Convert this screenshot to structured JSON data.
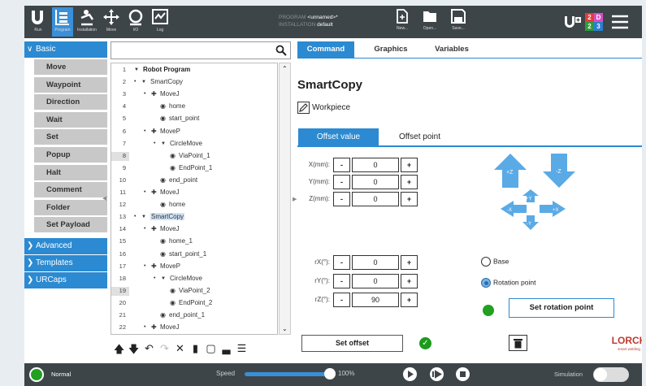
{
  "topbar": {
    "nav": [
      {
        "label": "Run",
        "icon": "ur-logo-icon"
      },
      {
        "label": "Program",
        "icon": "program-icon"
      },
      {
        "label": "Installation",
        "icon": "installation-icon"
      },
      {
        "label": "Move",
        "icon": "move-icon"
      },
      {
        "label": "I/O",
        "icon": "io-icon"
      },
      {
        "label": "Log",
        "icon": "log-icon"
      }
    ],
    "program_label": "PROGRAM",
    "program_name": "<unnamed>*",
    "installation_label": "INSTALLATION",
    "installation_name": "default",
    "file_buttons": [
      "New...",
      "Open...",
      "Save..."
    ],
    "counter_top": "2",
    "counter_d": "D",
    "counter_2": "2",
    "counter_3": "3"
  },
  "categories": {
    "basic": "Basic",
    "advanced": "Advanced",
    "templates": "Templates",
    "urcaps": "URCaps",
    "commands": [
      "Move",
      "Waypoint",
      "Direction",
      "Wait",
      "Set",
      "Popup",
      "Halt",
      "Comment",
      "Folder",
      "Set Payload"
    ]
  },
  "tree": {
    "rows": [
      {
        "n": "1",
        "text": "Robot Program"
      },
      {
        "n": "2",
        "text": "SmartCopy"
      },
      {
        "n": "3",
        "text": "MoveJ"
      },
      {
        "n": "4",
        "text": "home"
      },
      {
        "n": "5",
        "text": "start_point"
      },
      {
        "n": "6",
        "text": "MoveP"
      },
      {
        "n": "7",
        "text": "CircleMove"
      },
      {
        "n": "8",
        "text": "ViaPoint_1"
      },
      {
        "n": "9",
        "text": "EndPoint_1"
      },
      {
        "n": "10",
        "text": "end_point"
      },
      {
        "n": "11",
        "text": "MoveJ"
      },
      {
        "n": "12",
        "text": "home"
      },
      {
        "n": "13",
        "text": "SmartCopy"
      },
      {
        "n": "14",
        "text": "MoveJ"
      },
      {
        "n": "15",
        "text": "home_1"
      },
      {
        "n": "16",
        "text": "start_point_1"
      },
      {
        "n": "17",
        "text": "MoveP"
      },
      {
        "n": "18",
        "text": "CircleMove"
      },
      {
        "n": "19",
        "text": "ViaPoint_2"
      },
      {
        "n": "20",
        "text": "EndPoint_2"
      },
      {
        "n": "21",
        "text": "end_point_1"
      },
      {
        "n": "22",
        "text": "MoveJ"
      }
    ]
  },
  "right": {
    "tabs": [
      "Command",
      "Graphics",
      "Variables"
    ],
    "title": "SmartCopy",
    "workpiece": "Workpiece",
    "subtabs": [
      "Offset value",
      "Offset point"
    ],
    "fields": [
      {
        "label": "X(mm):",
        "value": "0"
      },
      {
        "label": "Y(mm):",
        "value": "0"
      },
      {
        "label": "Z(mm):",
        "value": "0"
      },
      {
        "label": "rX(°):",
        "value": "0"
      },
      {
        "label": "rY(°):",
        "value": "0"
      },
      {
        "label": "rZ(°):",
        "value": "90"
      }
    ],
    "minus": "-",
    "plus": "+",
    "arrows": [
      "+Z",
      "-Z",
      "+Y",
      "-X",
      "+X",
      "-Y"
    ],
    "radio_base": "Base",
    "radio_rotation": "Rotation point",
    "set_rotation_point": "Set rotation point",
    "set_offset": "Set offset",
    "logo_main": "LORCH",
    "logo_sub": "smart welding"
  },
  "bottombar": {
    "status": "Normal",
    "speed_label": "Speed",
    "speed_value": "100%",
    "speed_fraction": 1.0,
    "simulation_label": "Simulation"
  },
  "colors": {
    "accent": "#2b8ad1",
    "bar": "#3d4549",
    "ok": "#22a020",
    "lorch": "#c0392b"
  }
}
